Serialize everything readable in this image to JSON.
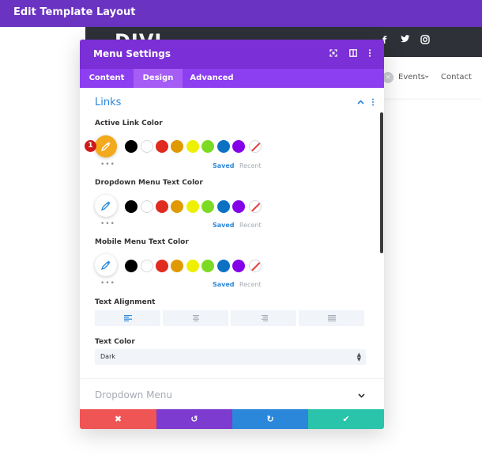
{
  "topbar": {
    "title": "Edit Template Layout"
  },
  "site": {
    "logo": "DIVI",
    "social": [
      "f",
      "t",
      "ig"
    ],
    "nav_close": "×",
    "nav_events": "Events",
    "nav_events_caret": "⌄",
    "nav_contact": "Contact"
  },
  "modal": {
    "title": "Menu Settings",
    "header_icons": [
      "expand-icon",
      "split-view-icon",
      "more-icon"
    ],
    "tabs": [
      {
        "label": "Content",
        "active": false
      },
      {
        "label": "Design",
        "active": true
      },
      {
        "label": "Advanced",
        "active": false
      }
    ],
    "section": {
      "title": "Links"
    },
    "color_fields": [
      {
        "label": "Active Link Color",
        "picker_color": "#f2a91c",
        "badge": "1"
      },
      {
        "label": "Dropdown Menu Text Color",
        "picker_color": "#ffffff"
      },
      {
        "label": "Mobile Menu Text Color",
        "picker_color": "#ffffff"
      }
    ],
    "swatches": [
      "#000000",
      "#ffffff",
      "#e02b20",
      "#e09900",
      "#edf000",
      "#7cda24",
      "#0c71c3",
      "#8300e9",
      "none"
    ],
    "dots": "•••",
    "saved_label": "Saved",
    "recent_label": "Recent",
    "text_alignment": {
      "label": "Text Alignment",
      "options": [
        "left",
        "center",
        "right",
        "justify"
      ],
      "selected": "left"
    },
    "text_color": {
      "label": "Text Color",
      "value": "Dark"
    },
    "collapsed_section": "Dropdown Menu",
    "footer": [
      {
        "name": "cancel",
        "glyph": "✖",
        "color": "#ef5555"
      },
      {
        "name": "undo",
        "glyph": "↺",
        "color": "#7d3bcf"
      },
      {
        "name": "redo",
        "glyph": "↻",
        "color": "#2b87da"
      },
      {
        "name": "save",
        "glyph": "✔",
        "color": "#29c4a9"
      }
    ]
  }
}
